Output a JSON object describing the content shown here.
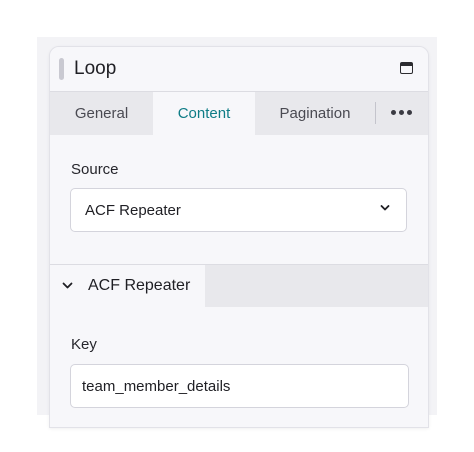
{
  "panel": {
    "title": "Loop",
    "icons": {
      "drag": "drag-handle-icon",
      "window": "window-icon",
      "more": "more-horizontal-icon"
    }
  },
  "tabs": [
    {
      "label": "General",
      "active": false
    },
    {
      "label": "Content",
      "active": true
    },
    {
      "label": "Pagination",
      "active": false
    }
  ],
  "source": {
    "label": "Source",
    "selected": "ACF Repeater"
  },
  "section": {
    "title": "ACF Repeater",
    "expanded": true
  },
  "key": {
    "label": "Key",
    "value": "team_member_details"
  },
  "colors": {
    "accent": "#0e7c86",
    "panel_bg": "#f7f7fa",
    "tab_bar_bg": "#e8e8ec"
  }
}
